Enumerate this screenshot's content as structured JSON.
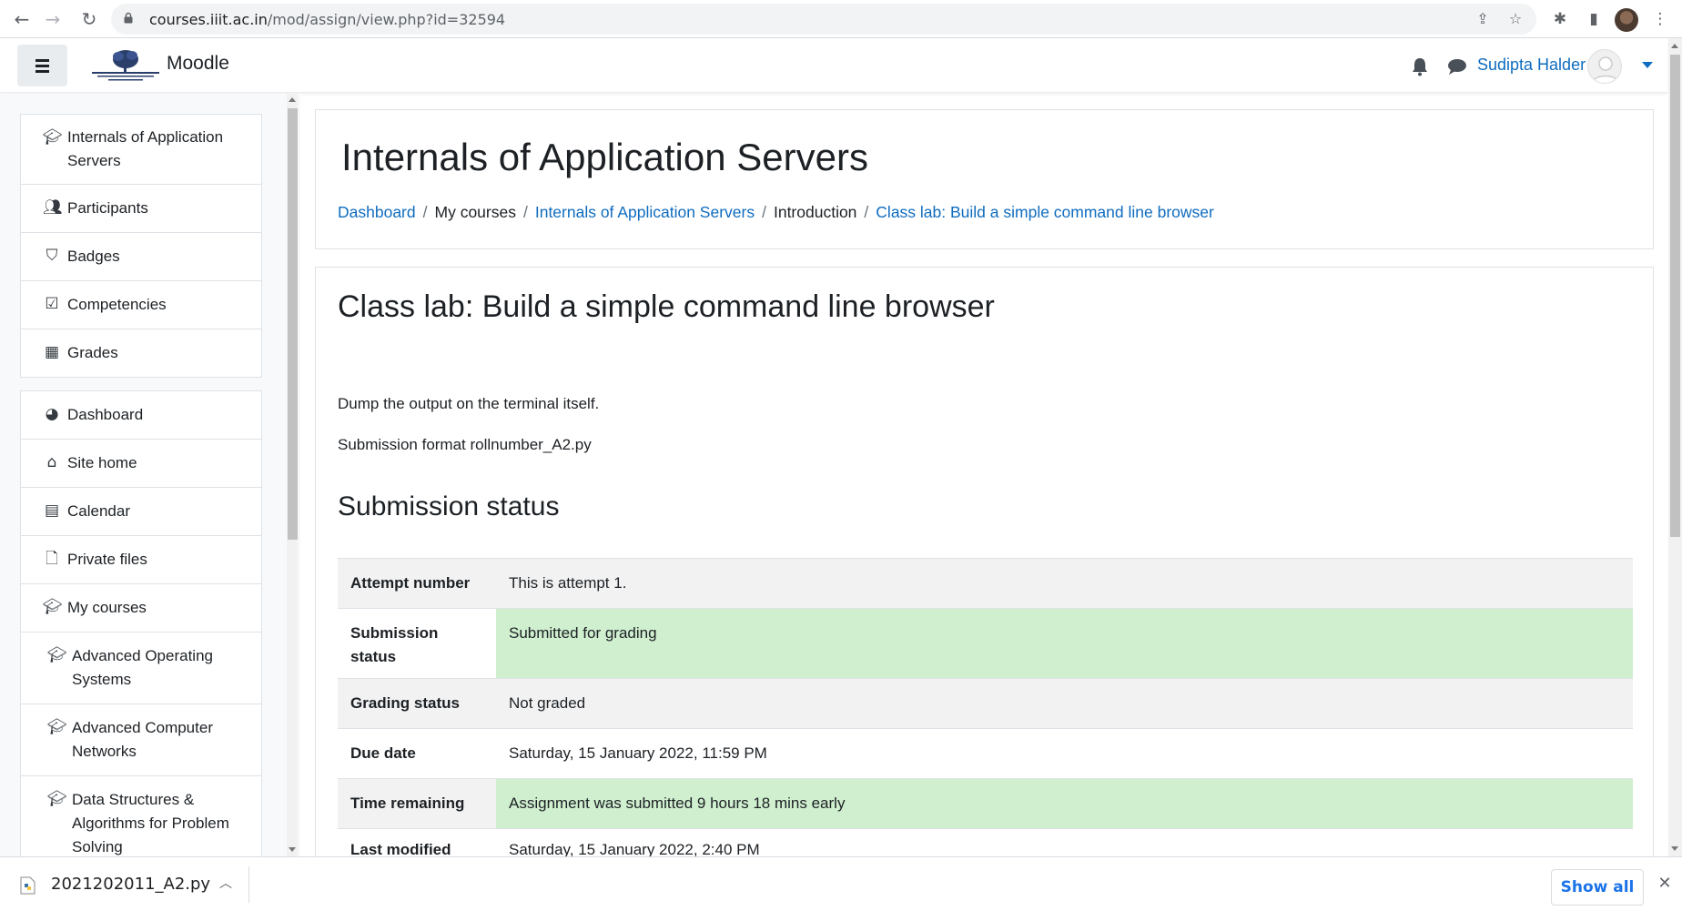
{
  "browser": {
    "url_host": "courses.iiit.ac.in",
    "url_path": "/mod/assign/view.php?id=32594",
    "icons": [
      "back-icon",
      "forward-icon",
      "reload-icon",
      "lock-icon",
      "share-icon",
      "bookmark-star-icon",
      "extensions-icon",
      "side-panel-icon",
      "profile-icon",
      "menu-icon"
    ]
  },
  "navbar": {
    "brand": "Moodle",
    "username": "Sudipta Halder"
  },
  "sidebar": {
    "course_group": [
      {
        "label": "Internals of Application Servers",
        "icon": "graduation-cap-icon"
      },
      {
        "label": "Participants",
        "icon": "users-icon"
      },
      {
        "label": "Badges",
        "icon": "shield-icon"
      },
      {
        "label": "Competencies",
        "icon": "check-square-icon"
      },
      {
        "label": "Grades",
        "icon": "table-icon"
      }
    ],
    "site_group": [
      {
        "label": "Dashboard",
        "icon": "dashboard-icon"
      },
      {
        "label": "Site home",
        "icon": "home-icon"
      },
      {
        "label": "Calendar",
        "icon": "calendar-icon"
      },
      {
        "label": "Private files",
        "icon": "file-icon"
      },
      {
        "label": "My courses",
        "icon": "graduation-cap-icon"
      },
      {
        "label": "Advanced Operating Systems",
        "icon": "graduation-cap-icon"
      },
      {
        "label": "Advanced Computer Networks",
        "icon": "graduation-cap-icon"
      },
      {
        "label": "Data Structures & Algorithms for Problem Solving",
        "icon": "graduation-cap-icon"
      }
    ]
  },
  "header": {
    "course_title": "Internals of Application Servers",
    "breadcrumb": [
      {
        "label": "Dashboard",
        "link": true
      },
      {
        "label": "My courses",
        "link": false
      },
      {
        "label": "Internals of Application Servers",
        "link": true
      },
      {
        "label": "Introduction",
        "link": false
      },
      {
        "label": "Class lab: Build a simple command line browser",
        "link": true
      }
    ]
  },
  "activity": {
    "title": "Class lab: Build a simple command line browser",
    "intro_1": "Dump the output on the terminal itself.",
    "intro_2": "Submission format rollnumber_A2.py",
    "status_heading": "Submission status",
    "rows": [
      {
        "label": "Attempt number",
        "value": "This is attempt 1.",
        "highlight": false
      },
      {
        "label": "Submission status",
        "value": "Submitted for grading",
        "highlight": true
      },
      {
        "label": "Grading status",
        "value": "Not graded",
        "highlight": false
      },
      {
        "label": "Due date",
        "value": "Saturday, 15 January 2022, 11:59 PM",
        "highlight": false
      },
      {
        "label": "Time remaining",
        "value": "Assignment was submitted 9 hours 18 mins early",
        "highlight": true
      },
      {
        "label": "Last modified",
        "value": "Saturday, 15 January 2022, 2:40 PM",
        "highlight": false
      }
    ],
    "colors": {
      "highlight": "#cfefcf",
      "link": "#0f6cbf"
    }
  },
  "downloads": {
    "file_name": "2021202011_A2.py",
    "show_all": "Show all"
  }
}
